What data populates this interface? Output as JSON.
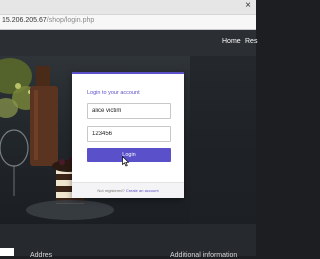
{
  "browser": {
    "url_host": "15.206.205.67",
    "url_path": "/shop/login.php",
    "close_glyph": "×"
  },
  "nav": {
    "home": "Home",
    "restaurant": "Res"
  },
  "login": {
    "heading": "Login to your account",
    "username_value": "alice victim",
    "password_value": "123456",
    "button_label": "Login",
    "footer_text": "Not registered?",
    "footer_link": "Create an account"
  },
  "footer": {
    "address_title": "Addres",
    "additional_title": "Additional information"
  },
  "colors": {
    "accent": "#5b50c7",
    "button": "#5a50c9",
    "navbar": "#2b2e33"
  }
}
